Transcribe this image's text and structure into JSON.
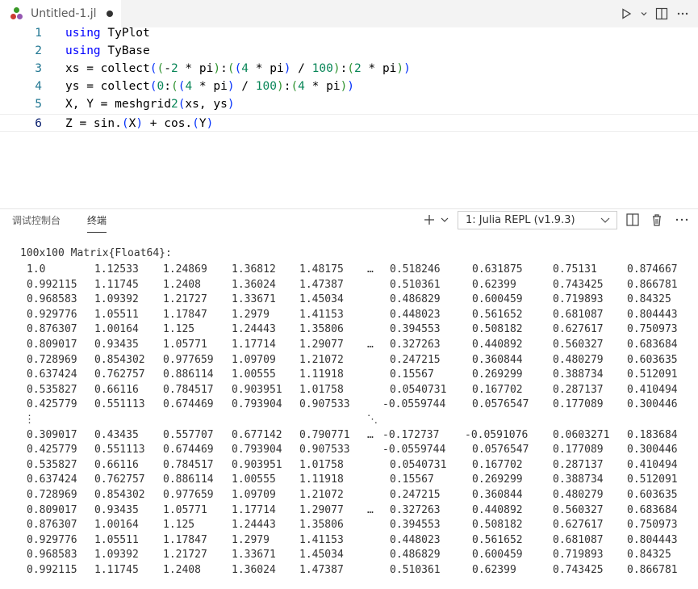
{
  "editor": {
    "tab_title": "Untitled-1.jl",
    "lines": [
      {
        "n": "1"
      },
      {
        "n": "2"
      },
      {
        "n": "3"
      },
      {
        "n": "4"
      },
      {
        "n": "5"
      },
      {
        "n": "6"
      }
    ],
    "code": {
      "l1_kw": "using",
      "l1_rest": " TyPlot",
      "l2_kw": "using",
      "l2_rest": " TyBase",
      "l3": "xs = collect((-2 * pi):((4 * pi) / 100):(2 * pi))",
      "l4": "ys = collect(0:((4 * pi) / 100):(4 * pi))",
      "l5": "X, Y = meshgrid2(xs, ys)",
      "l6": "Z = sin.(X) + cos.(Y)"
    }
  },
  "panel": {
    "tab_debug": "调试控制台",
    "tab_terminal": "终端",
    "terminal_select": "1: Julia REPL (v1.9.3)",
    "icons": [
      "plus-icon",
      "chevron-down-icon",
      "split-icon",
      "trash-icon",
      "ellipsis-icon"
    ]
  },
  "terminal": {
    "header": "100x100 Matrix{Float64}:",
    "rows": [
      [
        "1.0",
        "1.12533",
        "1.24869",
        "1.36812",
        "1.48175",
        "…",
        "0.518246",
        "0.631875",
        "0.75131",
        "0.874667"
      ],
      [
        "0.992115",
        "1.11745",
        "1.2408",
        "1.36024",
        "1.47387",
        "",
        "0.510361",
        "0.62399",
        "0.743425",
        "0.866781"
      ],
      [
        "0.968583",
        "1.09392",
        "1.21727",
        "1.33671",
        "1.45034",
        "",
        "0.486829",
        "0.600459",
        "0.719893",
        "0.84325"
      ],
      [
        "0.929776",
        "1.05511",
        "1.17847",
        "1.2979",
        "1.41153",
        "",
        "0.448023",
        "0.561652",
        "0.681087",
        "0.804443"
      ],
      [
        "0.876307",
        "1.00164",
        "1.125",
        "1.24443",
        "1.35806",
        "",
        "0.394553",
        "0.508182",
        "0.627617",
        "0.750973"
      ],
      [
        "0.809017",
        "0.93435",
        "1.05771",
        "1.17714",
        "1.29077",
        "…",
        "0.327263",
        "0.440892",
        "0.560327",
        "0.683684"
      ],
      [
        "0.728969",
        "0.854302",
        "0.977659",
        "1.09709",
        "1.21072",
        "",
        "0.247215",
        "0.360844",
        "0.480279",
        "0.603635"
      ],
      [
        "0.637424",
        "0.762757",
        "0.886114",
        "1.00555",
        "1.11918",
        "",
        "0.15567",
        "0.269299",
        "0.388734",
        "0.512091"
      ],
      [
        "0.535827",
        "0.66116",
        "0.784517",
        "0.903951",
        "1.01758",
        "",
        "0.0540731",
        "0.167702",
        "0.287137",
        "0.410494"
      ],
      [
        "0.425779",
        "0.551113",
        "0.674469",
        "0.793904",
        "0.907533",
        "",
        "-0.0559744",
        "0.0576547",
        "0.177089",
        "0.300446"
      ],
      [
        "⋮",
        "",
        "",
        "",
        "",
        "⋱",
        "",
        "",
        "",
        ""
      ],
      [
        "0.309017",
        "0.43435",
        "0.557707",
        "0.677142",
        "0.790771",
        "…",
        "-0.172737",
        "-0.0591076",
        "0.0603271",
        "0.183684"
      ],
      [
        "0.425779",
        "0.551113",
        "0.674469",
        "0.793904",
        "0.907533",
        "",
        "-0.0559744",
        "0.0576547",
        "0.177089",
        "0.300446"
      ],
      [
        "0.535827",
        "0.66116",
        "0.784517",
        "0.903951",
        "1.01758",
        "",
        "0.0540731",
        "0.167702",
        "0.287137",
        "0.410494"
      ],
      [
        "0.637424",
        "0.762757",
        "0.886114",
        "1.00555",
        "1.11918",
        "",
        "0.15567",
        "0.269299",
        "0.388734",
        "0.512091"
      ],
      [
        "0.728969",
        "0.854302",
        "0.977659",
        "1.09709",
        "1.21072",
        "",
        "0.247215",
        "0.360844",
        "0.480279",
        "0.603635"
      ],
      [
        "0.809017",
        "0.93435",
        "1.05771",
        "1.17714",
        "1.29077",
        "…",
        "0.327263",
        "0.440892",
        "0.560327",
        "0.683684"
      ],
      [
        "0.876307",
        "1.00164",
        "1.125",
        "1.24443",
        "1.35806",
        "",
        "0.394553",
        "0.508182",
        "0.627617",
        "0.750973"
      ],
      [
        "0.929776",
        "1.05511",
        "1.17847",
        "1.2979",
        "1.41153",
        "",
        "0.448023",
        "0.561652",
        "0.681087",
        "0.804443"
      ],
      [
        "0.968583",
        "1.09392",
        "1.21727",
        "1.33671",
        "1.45034",
        "",
        "0.486829",
        "0.600459",
        "0.719893",
        "0.84325"
      ],
      [
        "0.992115",
        "1.11745",
        "1.2408",
        "1.36024",
        "1.47387",
        "",
        "0.510361",
        "0.62399",
        "0.743425",
        "0.866781"
      ]
    ]
  }
}
